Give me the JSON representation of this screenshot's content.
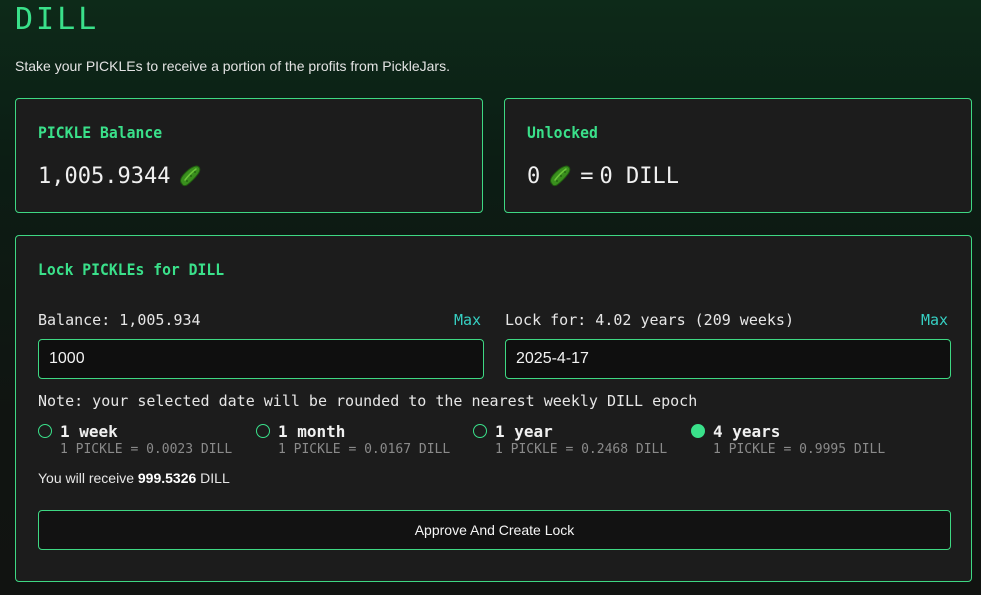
{
  "header": {
    "title": "DILL",
    "subtitle": "Stake your PICKLEs to receive a portion of the profits from PickleJars."
  },
  "balance_card": {
    "title": "PICKLE Balance",
    "value": "1,005.9344",
    "icon": "pickle-icon"
  },
  "unlocked_card": {
    "title": "Unlocked",
    "pickle_amount": "0",
    "equals": "=",
    "dill_amount": "0 DILL",
    "icon": "pickle-icon"
  },
  "lock_card": {
    "title": "Lock PICKLEs for DILL",
    "amount_field": {
      "label": "Balance: 1,005.934",
      "max_label": "Max",
      "value": "1000"
    },
    "date_field": {
      "label": "Lock for: 4.02 years (209 weeks)",
      "max_label": "Max",
      "value": "2025-4-17"
    },
    "note": "Note: your selected date will be rounded to the nearest weekly DILL epoch",
    "options": [
      {
        "label": "1 week",
        "rate": "1 PICKLE = 0.0023 DILL",
        "selected": false
      },
      {
        "label": "1 month",
        "rate": "1 PICKLE = 0.0167 DILL",
        "selected": false
      },
      {
        "label": "1 year",
        "rate": "1 PICKLE = 0.2468 DILL",
        "selected": false
      },
      {
        "label": "4 years",
        "rate": "1 PICKLE = 0.9995 DILL",
        "selected": true
      }
    ],
    "receive_prefix": "You will receive",
    "receive_amount": "999.5326",
    "receive_suffix": "DILL",
    "submit_label": "Approve And Create Lock"
  },
  "colors": {
    "accent": "#3ae08a",
    "max_link": "#36d0c3",
    "card_bg": "#1c1c1c",
    "border": "#3ed883"
  }
}
